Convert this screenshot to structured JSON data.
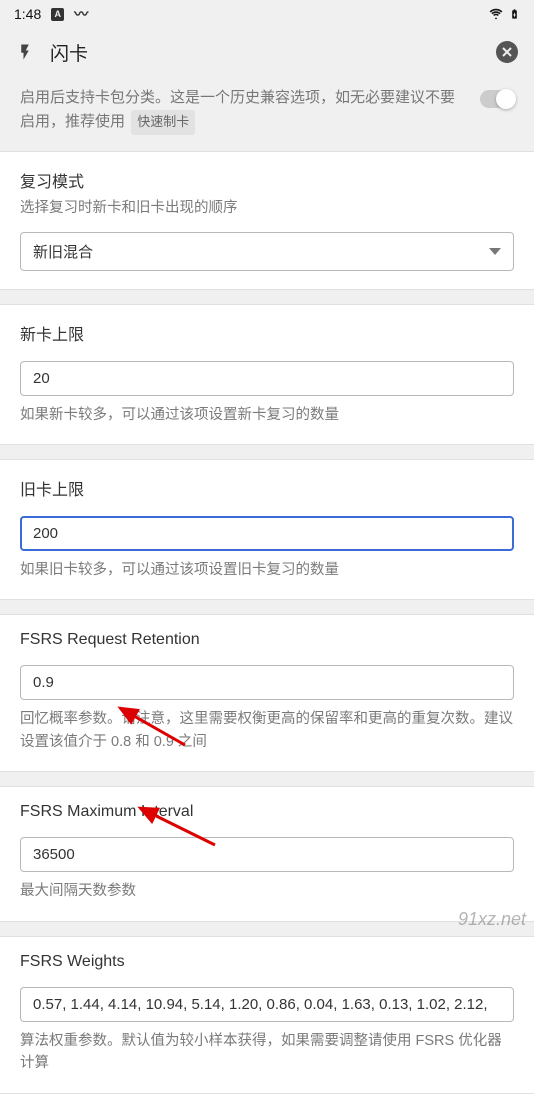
{
  "status": {
    "time": "1:48",
    "icon_a": "A",
    "icon_b": "M"
  },
  "header": {
    "title": "闪卡"
  },
  "intro": {
    "text_before": "启用后支持卡包分类。这是一个历史兼容选项，如无必要建议不要启用，推荐使用",
    "chip": "快速制卡"
  },
  "review_mode": {
    "label": "复习模式",
    "sub": "选择复习时新卡和旧卡出现的顺序",
    "value": "新旧混合"
  },
  "new_limit": {
    "label": "新卡上限",
    "value": "20",
    "desc": "如果新卡较多，可以通过该项设置新卡复习的数量"
  },
  "old_limit": {
    "label": "旧卡上限",
    "value": "200",
    "desc": "如果旧卡较多，可以通过该项设置旧卡复习的数量"
  },
  "retention": {
    "label": "FSRS Request Retention",
    "value": "0.9",
    "desc": "回忆概率参数。请注意，这里需要权衡更高的保留率和更高的重复次数。建议设置该值介于 0.8 和 0.9 之间"
  },
  "max_interval": {
    "label": "FSRS Maximum Interval",
    "value": "36500",
    "desc": "最大间隔天数参数"
  },
  "weights": {
    "label": "FSRS Weights",
    "value": "0.57, 1.44, 4.14, 10.94, 5.14, 1.20, 0.86, 0.04, 1.63, 0.13, 1.02, 2.12,",
    "desc": "算法权重参数。默认值为较小样本获得，如果需要调整请使用 FSRS 优化器计算"
  },
  "watermark": "91xz.net"
}
